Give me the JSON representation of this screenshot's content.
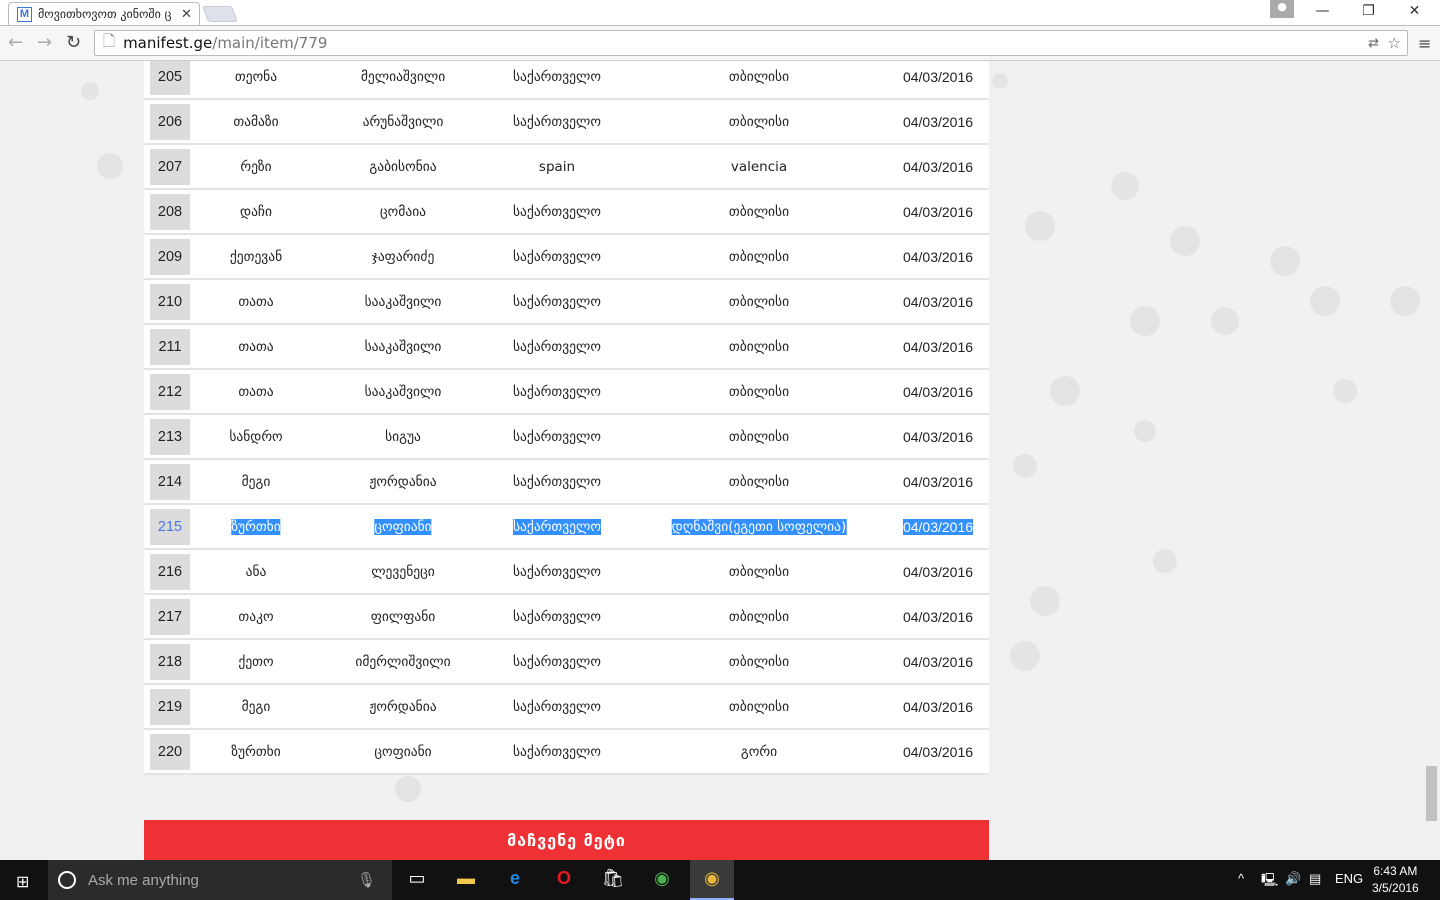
{
  "browser": {
    "tab_title": "მოვითხოვოთ კინოში ც",
    "favicon": "M",
    "url_host": "manifest.ge",
    "url_path": "/main/item/779"
  },
  "table": {
    "rows": [
      [
        "205",
        "თეონა",
        "მელიაშვილი",
        "საქართველო",
        "თბილისი",
        "04/03/2016"
      ],
      [
        "206",
        "თამაზი",
        "არუნაშვილი",
        "საქართველო",
        "თბილისი",
        "04/03/2016"
      ],
      [
        "207",
        "რეზი",
        "გაბისონია",
        "spain",
        "valencia",
        "04/03/2016"
      ],
      [
        "208",
        "დაჩი",
        "ცომაია",
        "საქართველო",
        "თბილისი",
        "04/03/2016"
      ],
      [
        "209",
        "ქეთევან",
        "ჯაფარიძე",
        "საქართველო",
        "თბილისი",
        "04/03/2016"
      ],
      [
        "210",
        "თათა",
        "სააკაშვილი",
        "საქართველო",
        "თბილისი",
        "04/03/2016"
      ],
      [
        "211",
        "თათა",
        "სააკაშვილი",
        "საქართველო",
        "თბილისი",
        "04/03/2016"
      ],
      [
        "212",
        "თათა",
        "სააკაშვილი",
        "საქართველო",
        "თბილისი",
        "04/03/2016"
      ],
      [
        "213",
        "სანდრო",
        "სიგუა",
        "საქართველო",
        "თბილისი",
        "04/03/2016"
      ],
      [
        "214",
        "მეგი",
        "ჟორდანია",
        "საქართველო",
        "თბილისი",
        "04/03/2016"
      ],
      [
        "215",
        "ზურთხი",
        "ცოფიანი",
        "საქართველო",
        "დღნაშვი(ეგეთი სოფელია)",
        "04/03/2016"
      ],
      [
        "216",
        "ანა",
        "ლევენეცი",
        "საქართველო",
        "თბილისი",
        "04/03/2016"
      ],
      [
        "217",
        "თაკო",
        "ფილფანი",
        "საქართველო",
        "თბილისი",
        "04/03/2016"
      ],
      [
        "218",
        "ქეთო",
        "იმერლიშვილი",
        "საქართველო",
        "თბილისი",
        "04/03/2016"
      ],
      [
        "219",
        "მეგი",
        "ჟორდანია",
        "საქართველო",
        "თბილისი",
        "04/03/2016"
      ],
      [
        "220",
        "ზურთხი",
        "ცოფიანი",
        "საქართველო",
        "გორი",
        "04/03/2016"
      ]
    ],
    "selected_row": "215"
  },
  "show_more_label": "მაჩვენე მეტი",
  "taskbar": {
    "search_placeholder": "Ask me anything",
    "language": "ENG",
    "time": "6:43 AM",
    "date": "3/5/2016"
  },
  "colors": {
    "accent": "#ee3135",
    "selection": "#3390ff"
  }
}
